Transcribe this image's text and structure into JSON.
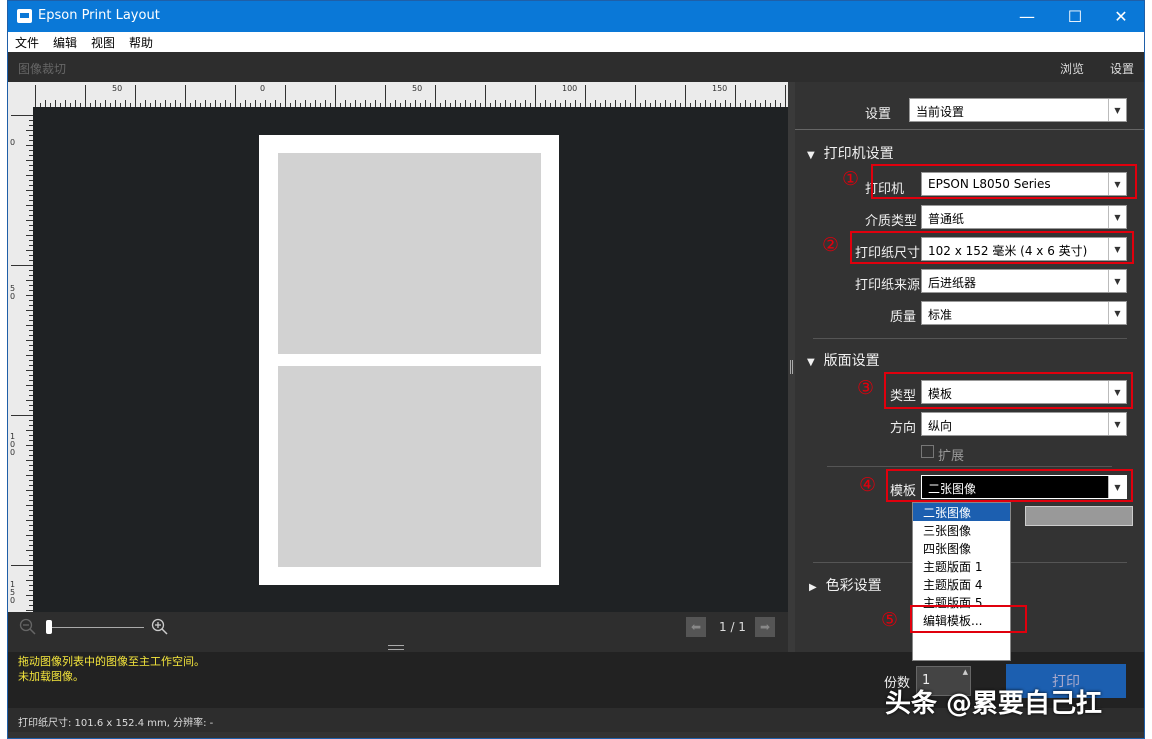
{
  "window": {
    "title": "Epson Print Layout",
    "minimize": "—",
    "maximize": "☐",
    "close": "✕"
  },
  "menu": {
    "file": "文件",
    "edit": "编辑",
    "view": "视图",
    "help": "帮助"
  },
  "toolbar": {
    "crop": "图像裁切",
    "browse": "浏览",
    "settings": "设置"
  },
  "ruler": {
    "h_labels": [
      "50",
      "0",
      "50",
      "100",
      "150"
    ],
    "v_labels": [
      "0",
      "5\n0",
      "1\n0\n0",
      "1\n5\n0"
    ]
  },
  "preview": {
    "page_indicator": "1 / 1"
  },
  "panel": {
    "settings_label": "设置",
    "settings_value": "当前设置",
    "printer_section": "打印机设置",
    "printer_label": "打印机",
    "printer_value": "EPSON L8050 Series",
    "media_label": "介质类型",
    "media_value": "普通纸",
    "paper_size_label": "打印纸尺寸",
    "paper_size_value": "102 x 152 毫米 (4 x 6 英寸)",
    "paper_source_label": "打印纸来源",
    "paper_source_value": "后进纸器",
    "quality_label": "质量",
    "quality_value": "标准",
    "layout_section": "版面设置",
    "type_label": "类型",
    "type_value": "模板",
    "orientation_label": "方向",
    "orientation_value": "纵向",
    "expand_label": "扩展",
    "template_label": "模板",
    "template_value": "二张图像",
    "color_section": "色彩设置",
    "copies_label": "份数",
    "copies_value": "1",
    "print_button": "打印"
  },
  "template_options": [
    "二张图像",
    "三张图像",
    "四张图像",
    "主题版面 1",
    "主题版面 4",
    "主题版面 5",
    "编辑模板..."
  ],
  "annotations": [
    "①",
    "②",
    "③",
    "④",
    "⑤"
  ],
  "status": {
    "line1": "拖动图像列表中的图像至主工作空间。",
    "line2": "未加载图像。",
    "bottom": "打印纸尺寸: 101.6 x 152.4 mm,   分辨率: -"
  },
  "watermark": "头条 @累要自己扛",
  "colors": {
    "title_bar": "#0a78d7",
    "annotation_red": "#e0000d",
    "status_text": "#f5e63c"
  }
}
